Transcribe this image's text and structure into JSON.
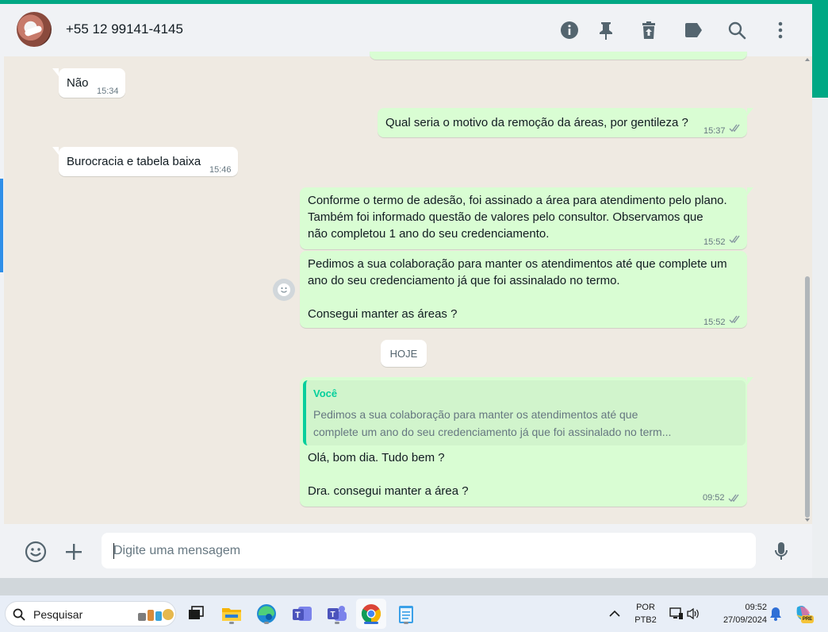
{
  "header": {
    "contact_name": "+55 12 99141-4145",
    "icons": [
      "info-icon",
      "pin-icon",
      "delete-icon",
      "label-icon",
      "search-icon",
      "more-icon"
    ]
  },
  "messages": [
    {
      "dir": "in",
      "text": "Não",
      "time": "15:34"
    },
    {
      "dir": "out",
      "text": "Qual seria o motivo da remoção da áreas, por gentileza ?",
      "time": "15:37"
    },
    {
      "dir": "in",
      "text": "Burocracia e tabela baixa",
      "time": "15:46"
    },
    {
      "dir": "out",
      "lines": [
        "Conforme o termo de adesão, foi assinado a área para atendimento pelo plano.",
        "Também foi informado questão de valores pelo consultor. Observamos que",
        "não completou 1 ano do seu credenciamento."
      ],
      "time": "15:52"
    },
    {
      "dir": "out",
      "lines": [
        "Pedimos a sua colaboração para manter os atendimentos até que complete um",
        "ano do seu credenciamento já que foi assinalado no termo.",
        "",
        "Consegui manter as áreas ?"
      ],
      "time": "15:52"
    },
    {
      "dir": "out",
      "quote": {
        "author": "Você",
        "lines": [
          "Pedimos a sua colaboração para manter os atendimentos até que",
          "complete um ano do seu credenciamento já que foi assinalado no term..."
        ]
      },
      "lines": [
        "Olá, bom dia. Tudo bem ?",
        "",
        "Dra. consegui manter a área ?"
      ],
      "time": "09:52"
    }
  ],
  "day_separator": "HOJE",
  "composer": {
    "placeholder": "Digite uma mensagem"
  },
  "taskbar": {
    "search_label": "Pesquisar",
    "lang_line1": "POR",
    "lang_line2": "PTB2",
    "clock_time": "09:52",
    "clock_date": "27/09/2024",
    "copilot_badge": "PRE"
  },
  "colors": {
    "accent": "#00a884",
    "outgoing": "#d9fdd3",
    "incoming": "#ffffff",
    "quote_author": "#06cf9c",
    "read_ticks": "#8696a0"
  }
}
